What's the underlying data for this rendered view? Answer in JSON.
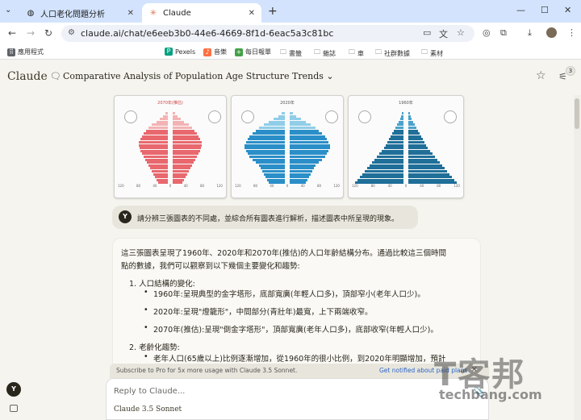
{
  "browser": {
    "tabs": [
      {
        "label": "人口老化問題分析",
        "active": false
      },
      {
        "label": "Claude",
        "active": true
      }
    ],
    "url": "claude.ai/chat/e6eeb3b0-44e6-4669-8f1d-6eac5a3c81bc",
    "bookmarks": [
      "應用程式",
      "Pexels",
      "音樂",
      "每日報單",
      "書籤",
      "雜誌",
      "車",
      "社群數據",
      "素材"
    ]
  },
  "app": {
    "logo": "Claude",
    "chat_title": "Comparative Analysis of Population Age Structure Trends",
    "badge_count": "3"
  },
  "pyramids": [
    {
      "title": "2070年(推估)",
      "color": "#e8686e",
      "light": "#f3b3b4"
    },
    {
      "title": "2020年",
      "color": "#2a8fc8",
      "light": "#8fcde8"
    },
    {
      "title": "1960年",
      "color": "#1f6f99",
      "light": "#4aa3cc"
    }
  ],
  "pyramid_axis_labels": [
    "120",
    "80",
    "40",
    "0",
    "40",
    "80",
    "120"
  ],
  "user_message": {
    "avatar": "Y",
    "text": "請分辨三張圖表的不同處，並綜合所有圖表進行解析，描述圖表中所呈現的現象。"
  },
  "response": {
    "intro_line1": "這三張圖表呈現了1960年、2020年和2070年(推估)的人口年齡結構分布。通過比較這三個時間",
    "intro_line2": "點的數據，我們可以觀察到以下幾個主要變化和趨勢:",
    "section1": "1. 人口結構的變化:",
    "b1": "1960年:呈現典型的金字塔形，底部寬廣(年輕人口多)，頂部窄小(老年人口少)。",
    "b2": "2020年:呈現\"燈籠形\"，中間部分(青壯年)最寬，上下兩端收窄。",
    "b3": "2070年(推估):呈現\"倒金字塔形\"，頂部寬廣(老年人口多)，底部收窄(年輕人口少)。",
    "section2": "2. 老齡化趨勢:",
    "b4": "老年人口(65歲以上)比例逐漸增加，從1960年的很小比例，到2020年明顯增加，預計"
  },
  "promo": {
    "text": "Subscribe to Pro for 5x more usage with Claude 3.5 Sonnet.",
    "link": "Get notified about paid plans"
  },
  "composer": {
    "placeholder": "Reply to Claude...",
    "model": "Claude 3.5 Sonnet"
  },
  "watermark": {
    "big": "T客邦",
    "small": "techbang.com"
  }
}
